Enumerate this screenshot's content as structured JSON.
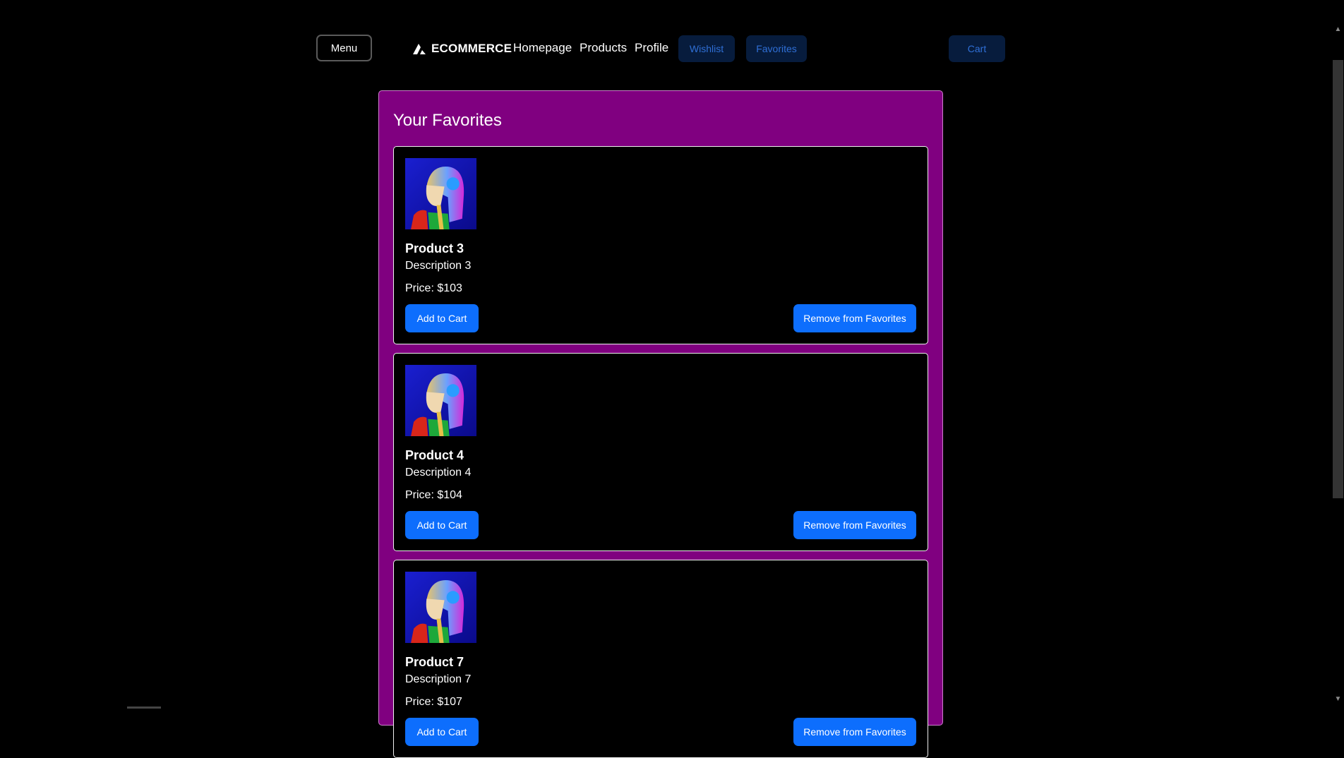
{
  "nav": {
    "menu_label": "Menu",
    "brand": "ECOMMERCE",
    "links": [
      "Homepage",
      "Products",
      "Profile"
    ],
    "wishlist_label": "Wishlist",
    "favorites_label": "Favorites",
    "cart_label": "Cart"
  },
  "favorites": {
    "title": "Your Favorites",
    "items": [
      {
        "name": "Product 3",
        "description": "Description 3",
        "price": "Price: $103",
        "add_label": "Add to Cart",
        "remove_label": "Remove from Favorites"
      },
      {
        "name": "Product 4",
        "description": "Description 4",
        "price": "Price: $104",
        "add_label": "Add to Cart",
        "remove_label": "Remove from Favorites"
      },
      {
        "name": "Product 7",
        "description": "Description 7",
        "price": "Price: $107",
        "add_label": "Add to Cart",
        "remove_label": "Remove from Favorites"
      }
    ]
  },
  "colors": {
    "page_bg": "#000000",
    "panel_bg": "#800080",
    "primary_button": "#0d6efd",
    "nav_pill_bg": "#071c3d",
    "nav_pill_text": "#2f6fd6"
  }
}
